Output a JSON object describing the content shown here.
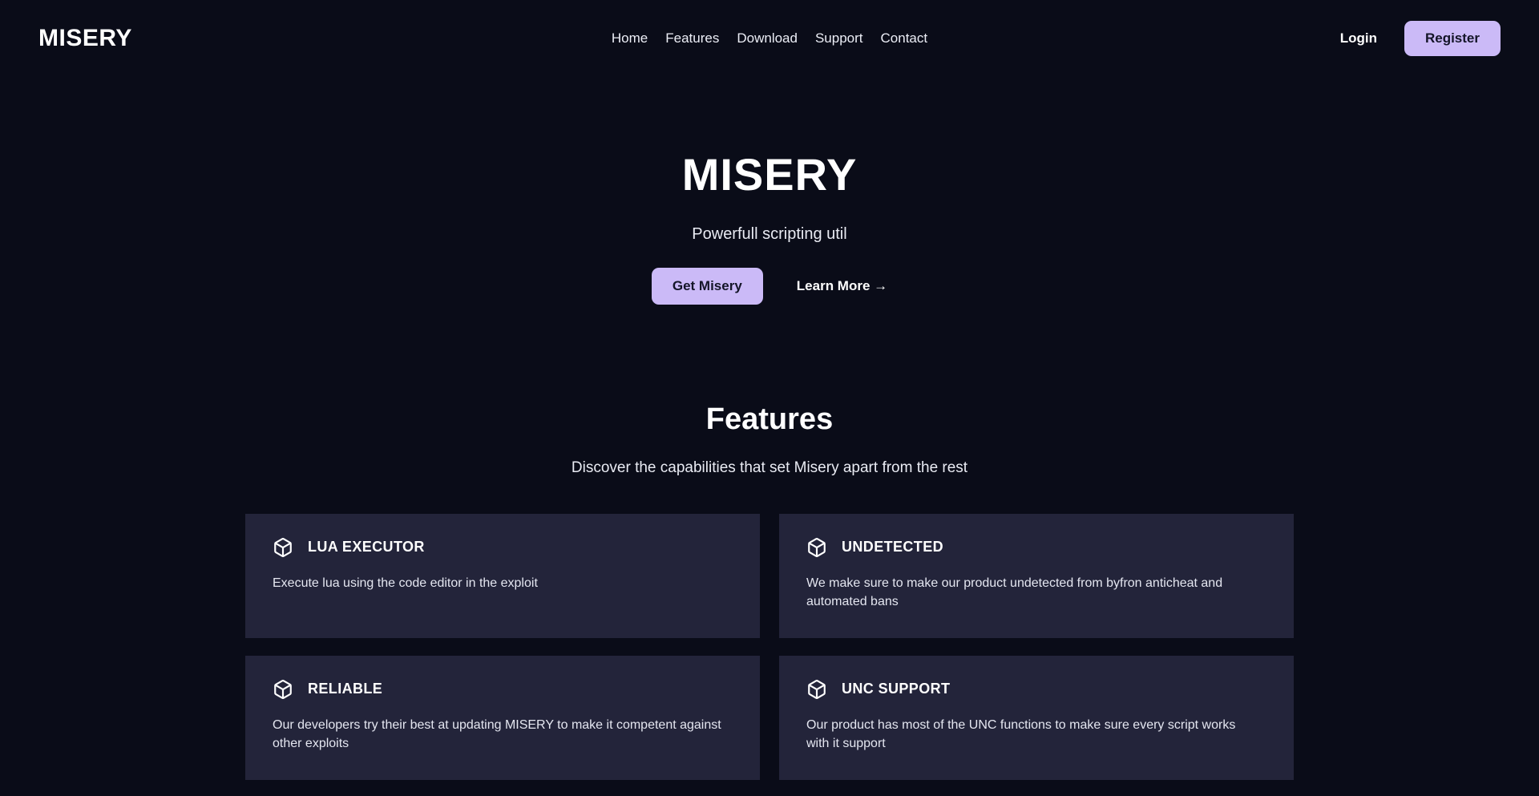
{
  "header": {
    "brand": "MISERY",
    "nav": [
      {
        "label": "Home",
        "name": "nav-home"
      },
      {
        "label": "Features",
        "name": "nav-features"
      },
      {
        "label": "Download",
        "name": "nav-download"
      },
      {
        "label": "Support",
        "name": "nav-support"
      },
      {
        "label": "Contact",
        "name": "nav-contact"
      }
    ],
    "login_label": "Login",
    "register_label": "Register"
  },
  "hero": {
    "title": "MISERY",
    "subtitle": "Powerfull scripting util",
    "primary_cta": "Get Misery",
    "secondary_cta": "Learn More →"
  },
  "features": {
    "title": "Features",
    "subtitle": "Discover the capabilities that set Misery apart from the rest",
    "cards": [
      {
        "icon": "box-icon",
        "title": "LUA EXECUTOR",
        "desc": "Execute lua using the code editor in the exploit"
      },
      {
        "icon": "box-icon",
        "title": "UNDETECTED",
        "desc": "We make sure to make our product undetected from byfron anticheat and automated bans"
      },
      {
        "icon": "box-icon",
        "title": "RELIABLE",
        "desc": "Our developers try their best at updating MISERY to make it competent against other exploits"
      },
      {
        "icon": "box-icon",
        "title": "UNC SUPPORT",
        "desc": "Our product has most of the UNC functions to make sure every script works with it support"
      }
    ]
  },
  "colors": {
    "background": "#0a0c18",
    "card": "#23243a",
    "accent": "#cbbaf7",
    "accent_text": "#141528",
    "text": "#ffffff",
    "muted_text": "#e4e6f0"
  }
}
